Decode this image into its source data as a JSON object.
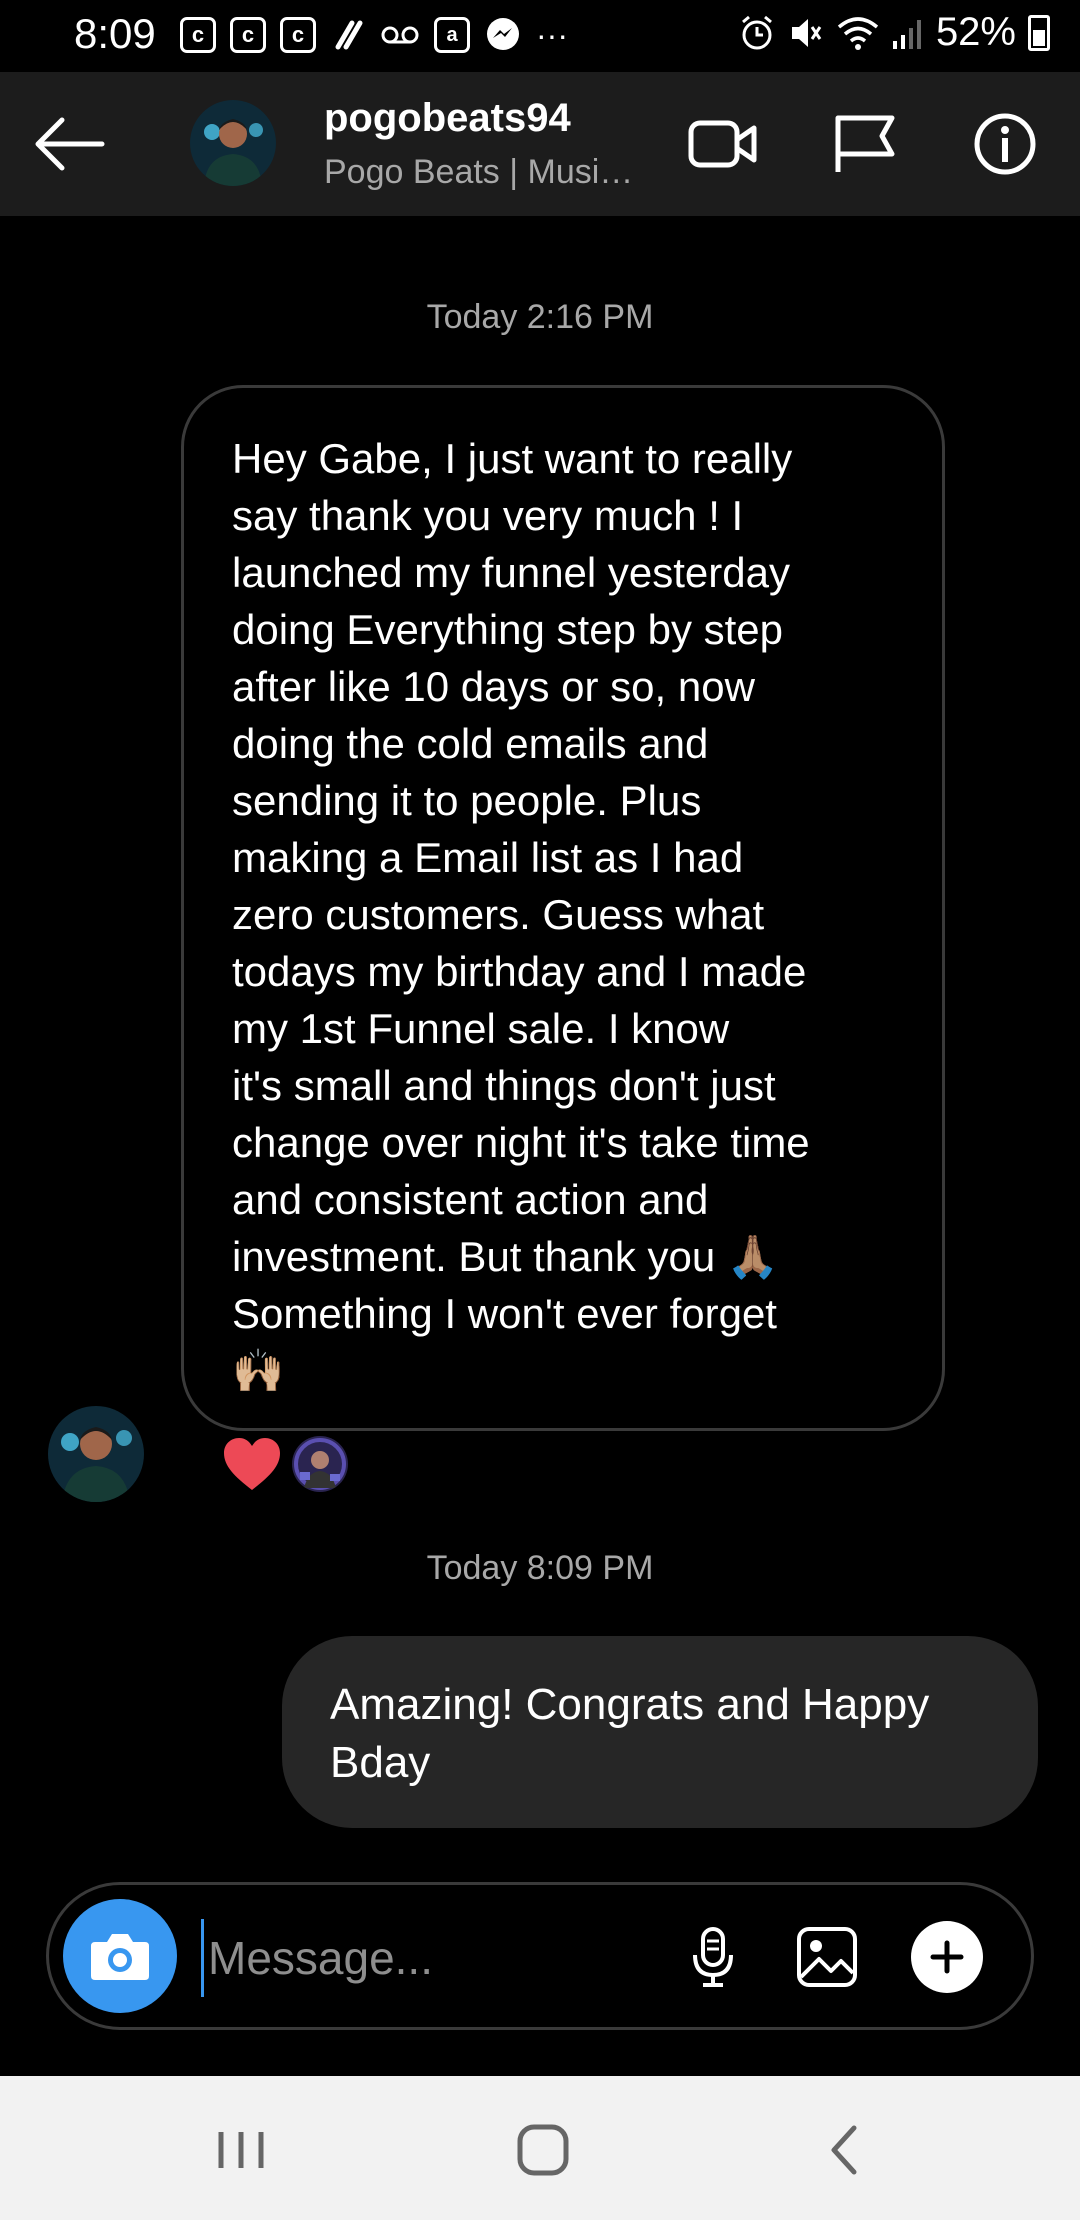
{
  "status_bar": {
    "time": "8:09",
    "left_icons": [
      "c-box-icon",
      "c-box-icon",
      "c-box-icon",
      "slash-icon",
      "voicemail-icon",
      "amazon-icon",
      "messenger-icon",
      "more-dots-icon"
    ],
    "right_icons": [
      "alarm-icon",
      "mute-icon",
      "wifi-icon",
      "signal-icon"
    ],
    "battery": "52%"
  },
  "header": {
    "username": "pogobeats94",
    "subtitle": "Pogo Beats | Musi…",
    "icons": [
      "video-call-icon",
      "flag-icon",
      "info-icon"
    ]
  },
  "messages": [
    {
      "timestamp": "Today 2:16 PM",
      "direction": "received",
      "lines": [
        "Hey Gabe, I just want to really",
        "say thank you very much ! I",
        "launched my funnel yesterday",
        "doing Everything step by step",
        "after like 10 days or so, now",
        "doing the cold emails and",
        "sending it to people. Plus",
        "making a Email list as I had",
        "zero customers. Guess what",
        "todays my birthday and I made",
        "my 1st Funnel sale. I know",
        "it's small and things don't just",
        "change over night it's take time",
        "and consistent action and",
        "investment. But thank you 🙏🏽",
        "Something I won't ever forget",
        "🙌🏼"
      ],
      "reaction": "heart"
    },
    {
      "timestamp": "Today 8:09 PM",
      "direction": "sent",
      "lines": [
        "Amazing! Congrats and Happy",
        "Bday"
      ]
    }
  ],
  "composer": {
    "placeholder": "Message...",
    "icons": [
      "camera-icon",
      "microphone-icon",
      "gallery-icon",
      "plus-icon"
    ]
  },
  "colors": {
    "background": "#000000",
    "header_bg": "#1c1c1c",
    "sent_bubble": "#262626",
    "accent_blue": "#3897f0",
    "heart_red": "#ed4956",
    "muted_text": "#a8a8a8"
  }
}
